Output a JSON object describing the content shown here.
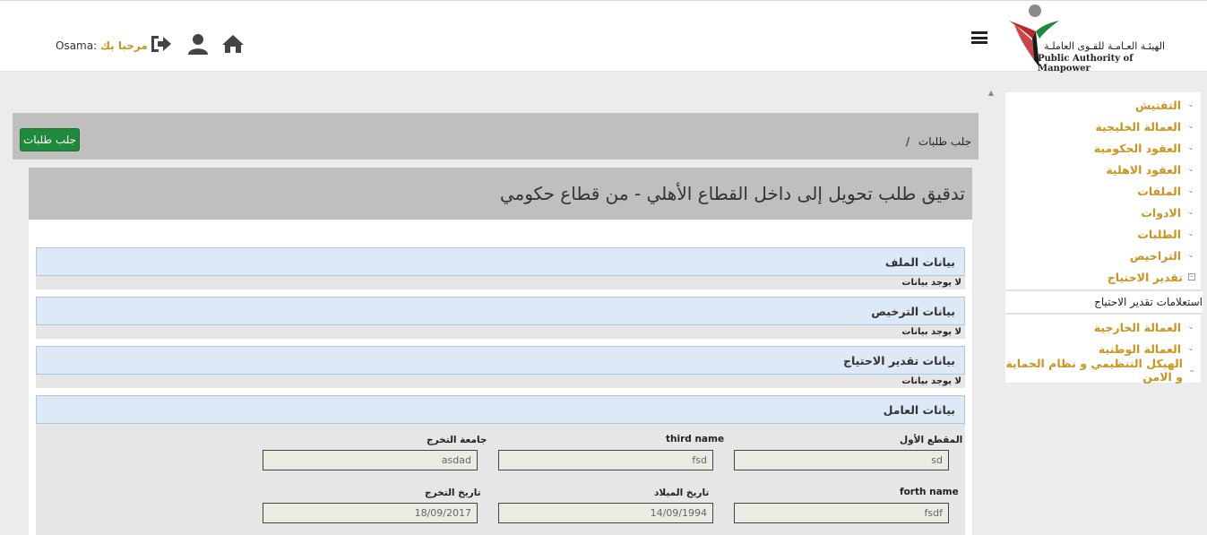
{
  "header": {
    "logo_ar": "الهيئـة العـامـة للقـوى العاملـة",
    "logo_en": "Public Authority of Manpower",
    "welcome_label": "مرحبا بك",
    "username": "Osama:"
  },
  "colors": {
    "accent_gold": "#c89520",
    "button_green": "#1f8a3c",
    "section_blue": "#dde9f6"
  },
  "icons": [
    "menu-icon",
    "home-icon",
    "user-icon",
    "logout-icon"
  ],
  "sidebar": {
    "items": [
      {
        "label": "التفتيش"
      },
      {
        "label": "العمالة الخليجية"
      },
      {
        "label": "العقود الحكومية"
      },
      {
        "label": "العقود الاهلية"
      },
      {
        "label": "الملفات"
      },
      {
        "label": "الادوات"
      },
      {
        "label": "الطلبات"
      },
      {
        "label": "التراخيص"
      },
      {
        "label": "تقدير الاحتياج"
      }
    ],
    "submenu": "استعلامات تقدير الاحتياج",
    "items_after": [
      {
        "label": "العمالة الخارجية"
      },
      {
        "label": "العمالة الوطنية"
      },
      {
        "label": "الهيكل التنظيمي و نظام الحماية و الامن"
      }
    ]
  },
  "breadcrumb": {
    "text": "جلب طلبات",
    "separator": "/"
  },
  "fetch_button": "جلب طلبات",
  "page_title": "تدقيق طلب تحويل إلى داخل القطاع الأهلي - من قطاع حكومي",
  "sections": [
    {
      "title": "بيانات الملف",
      "empty": "لا يوجد بيانات"
    },
    {
      "title": "بيانات الترخيص",
      "empty": "لا يوجد بيانات"
    },
    {
      "title": "بيانات تقدير الاحتياج",
      "empty": "لا يوجد بيانات"
    },
    {
      "title": "بيانات العامل"
    }
  ],
  "worker": {
    "fields": [
      {
        "label": "المقطع الأول",
        "value": "sd"
      },
      {
        "label": "third name",
        "value": "fsd"
      },
      {
        "label": "جامعة التخرج",
        "value": "asdad"
      },
      {
        "label": "forth name",
        "value": "fsdf"
      },
      {
        "label": "تاريخ الميلاد",
        "value": "14/09/1994"
      },
      {
        "label": "تاريخ التخرج",
        "value": "18/09/2017"
      }
    ]
  }
}
